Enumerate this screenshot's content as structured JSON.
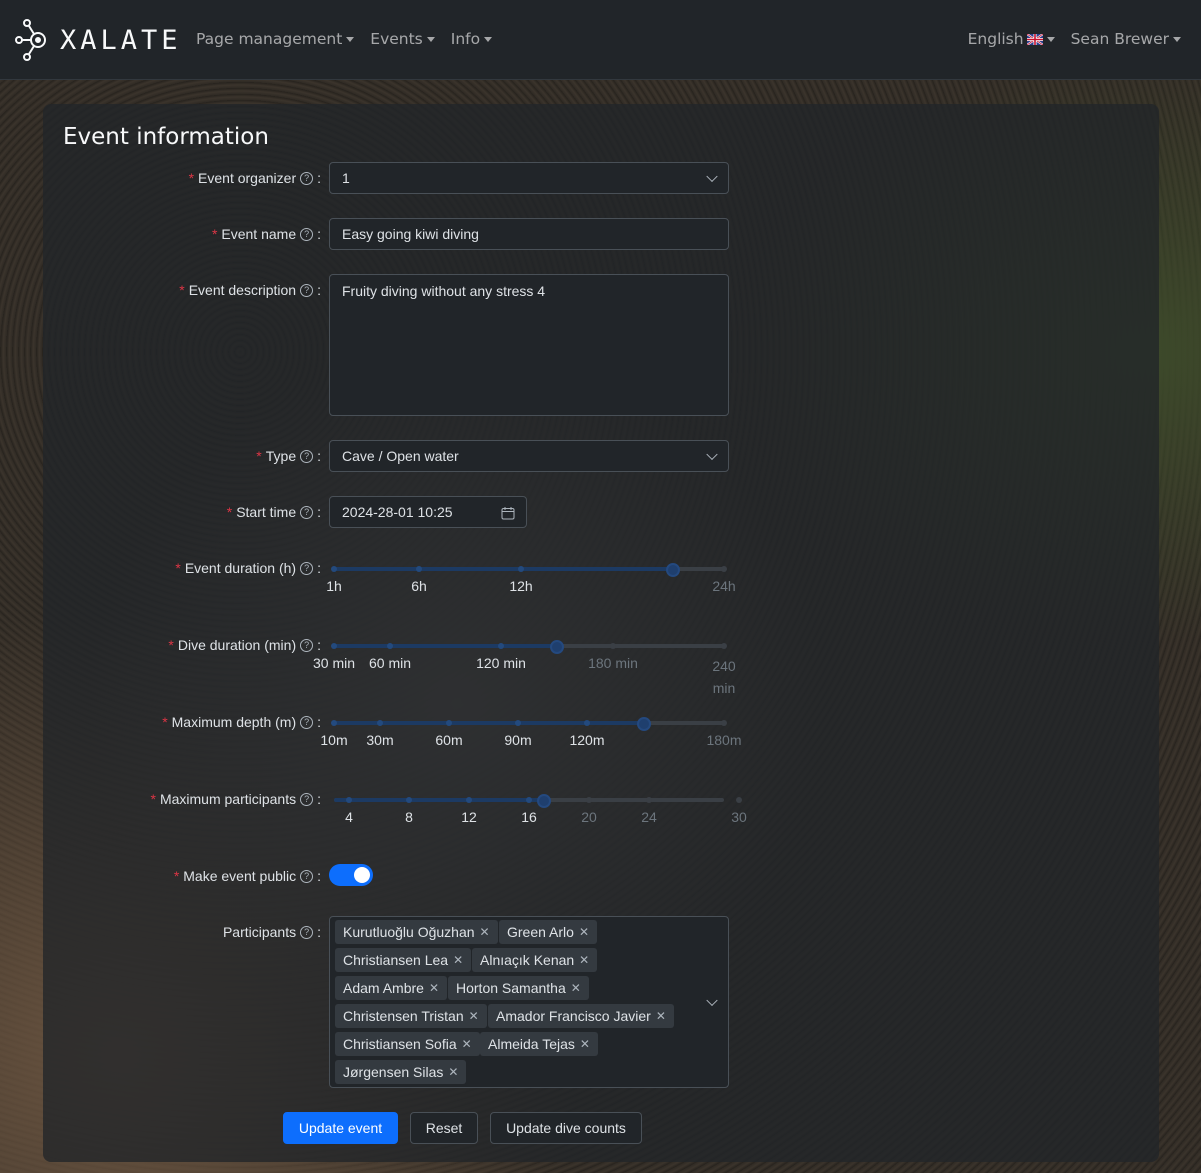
{
  "nav": {
    "brand": "XALATE",
    "menus": [
      "Page management",
      "Events",
      "Info"
    ],
    "language": "English",
    "user": "Sean Brewer"
  },
  "form": {
    "title": "Event information",
    "organizer": {
      "label": "Event organizer",
      "value": "1"
    },
    "name": {
      "label": "Event name",
      "value": "Easy going kiwi diving"
    },
    "description": {
      "label": "Event description",
      "value": "Fruity diving without any stress 4"
    },
    "type": {
      "label": "Type",
      "value": "Cave / Open water"
    },
    "start_time": {
      "label": "Start time",
      "value": "2024-28-01 10:25"
    },
    "event_duration": {
      "label": "Event duration (h)",
      "marks": [
        "1h",
        "6h",
        "12h",
        "24h"
      ],
      "value": 21
    },
    "dive_duration": {
      "label": "Dive duration (min)",
      "marks": [
        "30 min",
        "60 min",
        "120 min",
        "180 min",
        "240 min"
      ],
      "value": 150
    },
    "max_depth": {
      "label": "Maximum depth (m)",
      "marks": [
        "10m",
        "30m",
        "60m",
        "90m",
        "120m",
        "180m"
      ],
      "value": 144
    },
    "max_participants": {
      "label": "Maximum participants",
      "marks": [
        "4",
        "8",
        "12",
        "16",
        "20",
        "24",
        "30"
      ],
      "value": 17
    },
    "public": {
      "label": "Make event public",
      "value": true
    },
    "participants": {
      "label": "Participants",
      "list": [
        "Kurutluoğlu Oğuzhan",
        "Green Arlo",
        "Christiansen Lea",
        "Alnıaçık Kenan",
        "Adam Ambre",
        "Horton Samantha",
        "Christensen Tristan",
        "Amador Francisco Javier",
        "Christiansen Sofia",
        "Almeida Tejas",
        "Jørgensen Silas"
      ]
    },
    "buttons": {
      "update": "Update event",
      "reset": "Reset",
      "dive_counts": "Update dive counts"
    }
  },
  "colors": {
    "primary": "#0d6efd",
    "required": "#dc3545"
  }
}
